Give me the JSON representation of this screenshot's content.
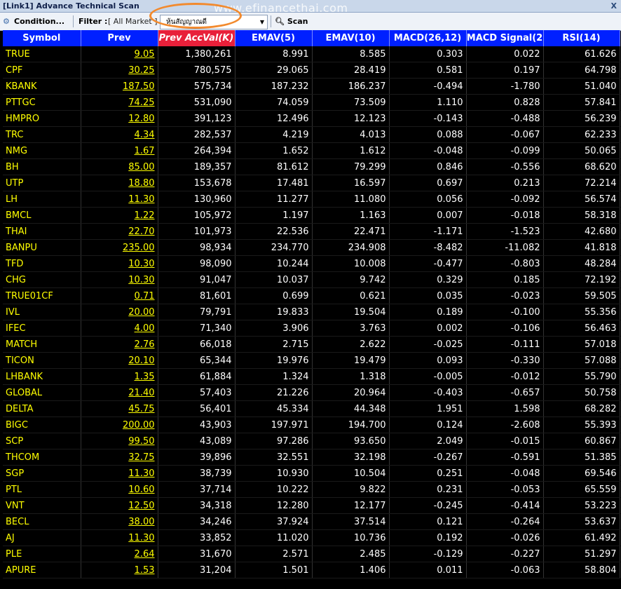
{
  "window": {
    "title": "[Link1] Advance Technical Scan",
    "close_glyph": "X"
  },
  "watermark": "www.efinancethai.com",
  "toolbar": {
    "condition_label": "Condition...",
    "filter_label": "Filter :",
    "filter_value": "[ All Market ]",
    "combo_value": "หุ้นสัญญาณดี",
    "scan_label": "Scan"
  },
  "columns": [
    "Symbol",
    "Prev",
    "Prev AccVal(K)",
    "EMAV(5)",
    "EMAV(10)",
    "MACD(26,12)",
    "MACD Signal(2",
    "RSI(14)"
  ],
  "rows": [
    [
      "TRUE",
      "9.05",
      "1,380,261",
      "8.991",
      "8.585",
      "0.303",
      "0.022",
      "61.626"
    ],
    [
      "CPF",
      "30.25",
      "780,575",
      "29.065",
      "28.419",
      "0.581",
      "0.197",
      "64.798"
    ],
    [
      "KBANK",
      "187.50",
      "575,734",
      "187.232",
      "186.237",
      "-0.494",
      "-1.780",
      "51.040"
    ],
    [
      "PTTGC",
      "74.25",
      "531,090",
      "74.059",
      "73.509",
      "1.110",
      "0.828",
      "57.841"
    ],
    [
      "HMPRO",
      "12.80",
      "391,123",
      "12.496",
      "12.123",
      "-0.143",
      "-0.488",
      "56.239"
    ],
    [
      "TRC",
      "4.34",
      "282,537",
      "4.219",
      "4.013",
      "0.088",
      "-0.067",
      "62.233"
    ],
    [
      "NMG",
      "1.67",
      "264,394",
      "1.652",
      "1.612",
      "-0.048",
      "-0.099",
      "50.065"
    ],
    [
      "BH",
      "85.00",
      "189,357",
      "81.612",
      "79.299",
      "0.846",
      "-0.556",
      "68.620"
    ],
    [
      "UTP",
      "18.80",
      "153,678",
      "17.481",
      "16.597",
      "0.697",
      "0.213",
      "72.214"
    ],
    [
      "LH",
      "11.30",
      "130,960",
      "11.277",
      "11.080",
      "0.056",
      "-0.092",
      "56.574"
    ],
    [
      "BMCL",
      "1.22",
      "105,972",
      "1.197",
      "1.163",
      "0.007",
      "-0.018",
      "58.318"
    ],
    [
      "THAI",
      "22.70",
      "101,973",
      "22.536",
      "22.471",
      "-1.171",
      "-1.523",
      "42.680"
    ],
    [
      "BANPU",
      "235.00",
      "98,934",
      "234.770",
      "234.908",
      "-8.482",
      "-11.082",
      "41.818"
    ],
    [
      "TFD",
      "10.30",
      "98,090",
      "10.244",
      "10.008",
      "-0.477",
      "-0.803",
      "48.284"
    ],
    [
      "CHG",
      "10.30",
      "91,047",
      "10.037",
      "9.742",
      "0.329",
      "0.185",
      "72.192"
    ],
    [
      "TRUE01CF",
      "0.71",
      "81,601",
      "0.699",
      "0.621",
      "0.035",
      "-0.023",
      "59.505"
    ],
    [
      "IVL",
      "20.00",
      "79,791",
      "19.833",
      "19.504",
      "0.189",
      "-0.100",
      "55.356"
    ],
    [
      "IFEC",
      "4.00",
      "71,340",
      "3.906",
      "3.763",
      "0.002",
      "-0.106",
      "56.463"
    ],
    [
      "MATCH",
      "2.76",
      "66,018",
      "2.715",
      "2.622",
      "-0.025",
      "-0.111",
      "57.018"
    ],
    [
      "TICON",
      "20.10",
      "65,344",
      "19.976",
      "19.479",
      "0.093",
      "-0.330",
      "57.088"
    ],
    [
      "LHBANK",
      "1.35",
      "61,884",
      "1.324",
      "1.318",
      "-0.005",
      "-0.012",
      "55.790"
    ],
    [
      "GLOBAL",
      "21.40",
      "57,403",
      "21.226",
      "20.964",
      "-0.403",
      "-0.657",
      "50.758"
    ],
    [
      "DELTA",
      "45.75",
      "56,401",
      "45.334",
      "44.348",
      "1.951",
      "1.598",
      "68.282"
    ],
    [
      "BIGC",
      "200.00",
      "43,903",
      "197.971",
      "194.700",
      "0.124",
      "-2.608",
      "55.393"
    ],
    [
      "SCP",
      "99.50",
      "43,089",
      "97.286",
      "93.650",
      "2.049",
      "-0.015",
      "60.867"
    ],
    [
      "THCOM",
      "32.75",
      "39,896",
      "32.551",
      "32.198",
      "-0.267",
      "-0.591",
      "51.385"
    ],
    [
      "SGP",
      "11.30",
      "38,739",
      "10.930",
      "10.504",
      "0.251",
      "-0.048",
      "69.546"
    ],
    [
      "PTL",
      "10.60",
      "37,714",
      "10.222",
      "9.822",
      "0.231",
      "-0.053",
      "65.559"
    ],
    [
      "VNT",
      "12.50",
      "34,318",
      "12.280",
      "12.177",
      "-0.245",
      "-0.414",
      "53.223"
    ],
    [
      "BECL",
      "38.00",
      "34,246",
      "37.924",
      "37.514",
      "0.121",
      "-0.264",
      "53.637"
    ],
    [
      "AJ",
      "11.30",
      "33,852",
      "11.020",
      "10.736",
      "0.192",
      "-0.026",
      "61.492"
    ],
    [
      "PLE",
      "2.64",
      "31,670",
      "2.571",
      "2.485",
      "-0.129",
      "-0.227",
      "51.297"
    ],
    [
      "APURE",
      "1.53",
      "31,204",
      "1.501",
      "1.406",
      "0.011",
      "-0.063",
      "58.804"
    ]
  ],
  "colors": {
    "header_bg": "#0020ff",
    "active_header_bg": "#e8203a",
    "symbol_text": "#ffff00",
    "value_text": "#ffffff",
    "grid_bg": "#000000",
    "highlight_oval": "#f28a2e"
  }
}
